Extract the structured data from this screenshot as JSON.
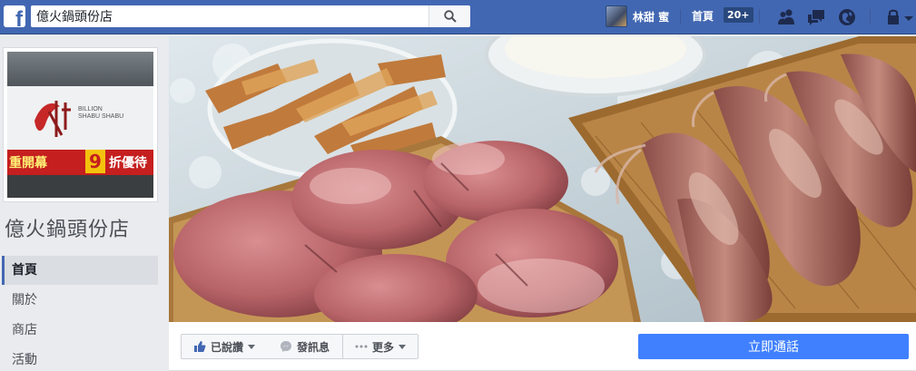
{
  "topbar": {
    "logo": "f",
    "search": {
      "value": "億火鍋頭份店",
      "placeholder": ""
    },
    "user": {
      "name": "林甜 蜜"
    },
    "home": {
      "label": "首頁",
      "badge": "20+"
    },
    "icons": [
      "friends-icon",
      "messages-icon",
      "notifications-icon",
      "help-icon",
      "account-menu-icon"
    ],
    "colors": {
      "bar": "#4267b2",
      "border": "#29487d"
    }
  },
  "profile": {
    "sign_brand_line1": "BILLION",
    "sign_brand_line2": "SHABU SHABU",
    "sign_banner_left": "重開幕",
    "sign_banner_number": "9",
    "sign_banner_right": "折優待"
  },
  "page": {
    "name": "億火鍋頭份店"
  },
  "sidebar": {
    "items": [
      {
        "label": "首頁",
        "active": true
      },
      {
        "label": "關於",
        "active": false
      },
      {
        "label": "商店",
        "active": false
      },
      {
        "label": "活動",
        "active": false
      }
    ]
  },
  "actions": {
    "like_label": "已說讚",
    "message_label": "發訊息",
    "more_label": "更多",
    "cta_label": "立即通話",
    "cta_color": "#4080ff"
  }
}
